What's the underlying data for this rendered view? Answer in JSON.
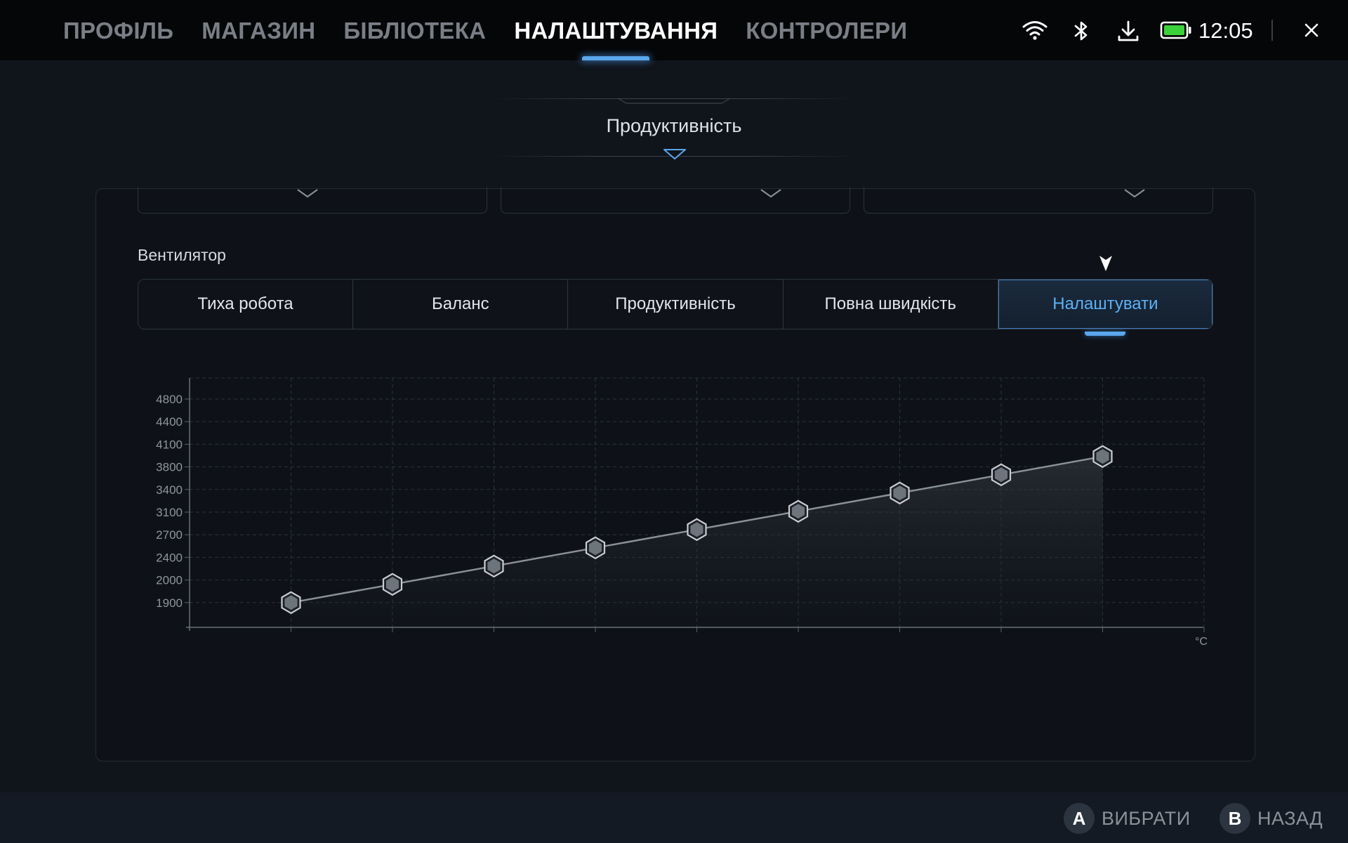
{
  "nav": {
    "tabs": [
      {
        "label": "ПРОФІЛЬ",
        "active": false
      },
      {
        "label": "МАГАЗИН",
        "active": false
      },
      {
        "label": "БІБЛІОТЕКА",
        "active": false
      },
      {
        "label": "НАЛАШТУВАННЯ",
        "active": true
      },
      {
        "label": "КОНТРОЛЕРИ",
        "active": false
      }
    ]
  },
  "status": {
    "time": "12:05",
    "icons": [
      "wifi-icon",
      "bluetooth-icon",
      "download-icon",
      "battery-icon",
      "close-icon"
    ],
    "battery_color": "#3ad13a"
  },
  "section": {
    "title": "Продуктивність"
  },
  "fan": {
    "label": "Вентилятор",
    "modes": [
      "Тиха робота",
      "Баланс",
      "Продуктивність",
      "Повна швидкість",
      "Налаштувати"
    ],
    "active_mode": "Налаштувати"
  },
  "chart_data": {
    "type": "line",
    "title": "",
    "xlabel": "°C",
    "ylabel": "",
    "y_tick_labels": [
      "4800",
      "4400",
      "4100",
      "3800",
      "3400",
      "3100",
      "2700",
      "2400",
      "2000",
      "1900"
    ],
    "points_y": [
      1900,
      2000,
      2400,
      2700,
      3100,
      3400,
      3800,
      4100,
      4400
    ],
    "x_count": 10,
    "grid": true,
    "fill_area": true,
    "line_color": "#8a8f98",
    "marker": "hexagon"
  },
  "footer": {
    "select": {
      "key": "A",
      "label": "ВИБРАТИ"
    },
    "back": {
      "key": "B",
      "label": "НАЗАД"
    }
  },
  "colors": {
    "accent": "#5aa7ec",
    "background": "#10141b"
  }
}
